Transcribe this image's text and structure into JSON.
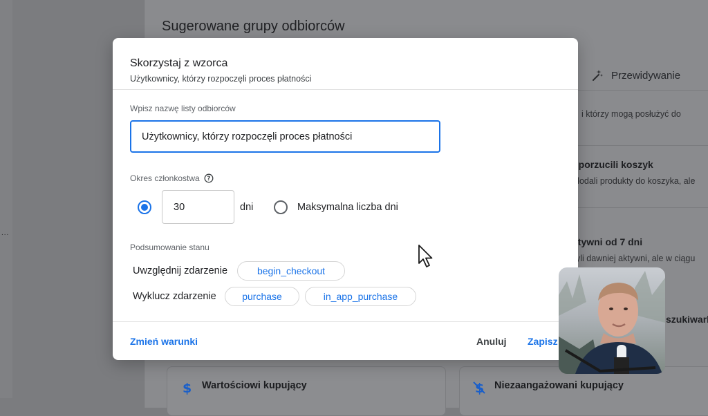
{
  "background": {
    "panel_title": "Sugerowane grupy odbiorców",
    "prediction_tab": "Przewidywanie",
    "snippets": [
      "i którzy mogą posłużyć do",
      "y porzucili koszyk",
      "dodali produkty do koszyka, ale",
      "ktywni od 7 dni",
      "yli dawniej aktywni, ale w ciągu",
      "szukiwark"
    ],
    "cards": [
      {
        "label": "Wartościowi kupujący",
        "icon": "dollar-icon"
      },
      {
        "label": "Niezaangażowani kupujący",
        "icon": "dollar-off-icon"
      }
    ]
  },
  "dialog": {
    "title": "Skorzystaj z wzorca",
    "subtitle": "Użytkownicy, którzy rozpoczęli proces płatności",
    "name_field_label": "Wpisz nazwę listy odbiorców",
    "name_value": "Użytkownicy, którzy rozpoczęli proces płatności",
    "membership_label": "Okres członkostwa",
    "days_value": "30",
    "days_unit": "dni",
    "max_days_label": "Maksymalna liczba dni",
    "summary_label": "Podsumowanie stanu",
    "include_label": "Uwzględnij zdarzenie",
    "include_events": [
      "begin_checkout"
    ],
    "exclude_label": "Wyklucz zdarzenie",
    "exclude_events": [
      "purchase",
      "in_app_purchase"
    ],
    "change_conditions": "Zmień warunki",
    "cancel": "Anuluj",
    "save": "Zapisz"
  },
  "colors": {
    "accent": "#1a73e8",
    "overlay_bg": "#7b7c7f"
  }
}
